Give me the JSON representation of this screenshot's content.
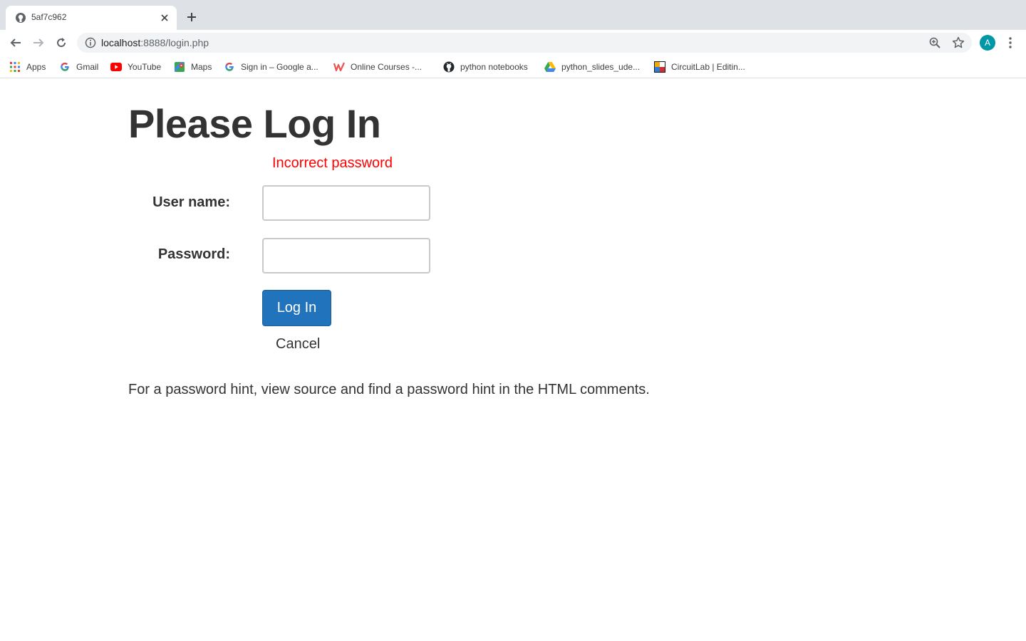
{
  "browser": {
    "tab": {
      "title": "5af7c962"
    },
    "address_bar": {
      "host": "localhost",
      "path": ":8888/login.php"
    },
    "profile_initial": "A",
    "bookmarks": [
      {
        "label": "Apps",
        "icon": "apps-grid-icon"
      },
      {
        "label": "Gmail",
        "icon": "google-icon"
      },
      {
        "label": "YouTube",
        "icon": "youtube-icon"
      },
      {
        "label": "Maps",
        "icon": "maps-icon"
      },
      {
        "label": "Sign in – Google a...",
        "icon": "google-icon"
      },
      {
        "label": "Online Courses -...",
        "icon": "udemy-icon"
      },
      {
        "label": "python notebooks",
        "icon": "github-icon"
      },
      {
        "label": "python_slides_ude...",
        "icon": "google-drive-icon"
      },
      {
        "label": "CircuitLab | Editin...",
        "icon": "circuitlab-icon"
      }
    ]
  },
  "page": {
    "title": "Please Log In",
    "error": "Incorrect password",
    "form": {
      "username_label": "User name:",
      "username_value": "",
      "password_label": "Password:",
      "password_value": "",
      "login_label": "Log In",
      "cancel_label": "Cancel"
    },
    "hint": "For a password hint, view source and find a password hint in the HTML comments."
  },
  "colors": {
    "error": "#ff0000",
    "button": "#2173bb",
    "text": "#333333"
  }
}
